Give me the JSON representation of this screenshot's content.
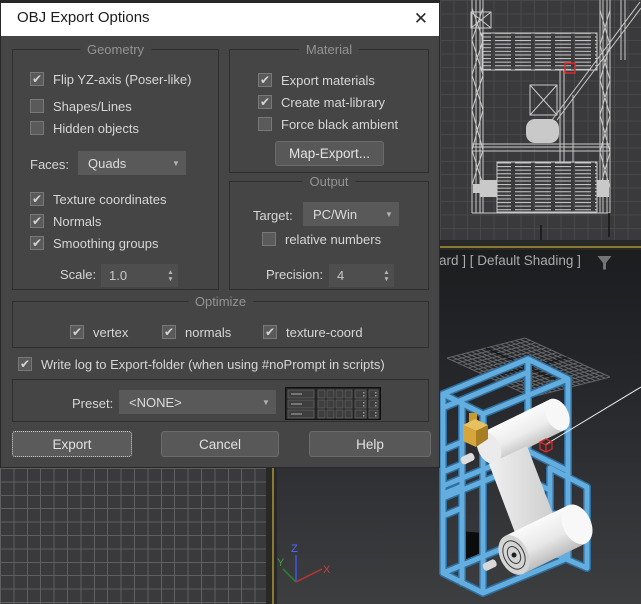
{
  "colors": {
    "dialog_bg": "#454545",
    "titlebar_bg": "#ffffff",
    "titlebar_text": "#1c1c1c",
    "label_text": "#d6d6d6",
    "group_title": "#939393",
    "control_bg": "#595959",
    "field_bg": "#4e4e4e",
    "button_bg": "#585858",
    "active_border_olive": "#8a7b30",
    "viewport_bg": "#3a3a3c",
    "grid_line_dim": "#48484b",
    "grid_line_bright": "#5f5f61",
    "wireframe": "#c9c9c9",
    "selection_red": "#d42a2a",
    "frame_blue": "#63aede",
    "frame_blue_dark": "#2f6f9f",
    "box_yellow": "#d6a63c",
    "axis_x_red": "#c04040",
    "axis_y_green": "#3f9f3f",
    "axis_z_blue": "#4f6bff",
    "persp_bg_top": "#1b1d1f",
    "persp_bg_bottom": "#3d3e40"
  },
  "dialog": {
    "title": "OBJ Export Options",
    "close_icon": "✕",
    "geometry": {
      "title": "Geometry",
      "checkboxes": [
        {
          "label": "Flip YZ-axis (Poser-like)",
          "checked": true
        },
        {
          "label": "Shapes/Lines",
          "checked": false
        },
        {
          "label": "Hidden objects",
          "checked": false
        },
        {
          "label": "Texture coordinates",
          "checked": true
        },
        {
          "label": "Normals",
          "checked": true
        },
        {
          "label": "Smoothing groups",
          "checked": true
        }
      ],
      "faces_label": "Faces:",
      "faces_value": "Quads",
      "scale_label": "Scale:",
      "scale_value": "1.0"
    },
    "material": {
      "title": "Material",
      "checkboxes": [
        {
          "label": "Export materials",
          "checked": true
        },
        {
          "label": "Create mat-library",
          "checked": true
        },
        {
          "label": "Force black ambient",
          "checked": false
        }
      ],
      "map_export_button": "Map-Export..."
    },
    "output": {
      "title": "Output",
      "target_label": "Target:",
      "target_value": "PC/Win",
      "relative_numbers": {
        "label": "relative numbers",
        "checked": false
      },
      "precision_label": "Precision:",
      "precision_value": "4"
    },
    "optimize": {
      "title": "Optimize",
      "checkboxes": [
        {
          "label": "vertex",
          "checked": true
        },
        {
          "label": "normals",
          "checked": true
        },
        {
          "label": "texture-coord",
          "checked": true
        }
      ]
    },
    "write_log": {
      "label": "Write log to Export-folder (when using #noPrompt in scripts)",
      "checked": true
    },
    "preset": {
      "label": "Preset:",
      "value": "<NONE>"
    },
    "buttons": {
      "export": "Export",
      "cancel": "Cancel",
      "help": "Help"
    }
  },
  "viewports": {
    "perspective": {
      "label_partial": "ard ] [ Default Shading ]"
    },
    "axis_gizmo": {
      "x": "X",
      "y": "Y",
      "z": "Z"
    }
  }
}
